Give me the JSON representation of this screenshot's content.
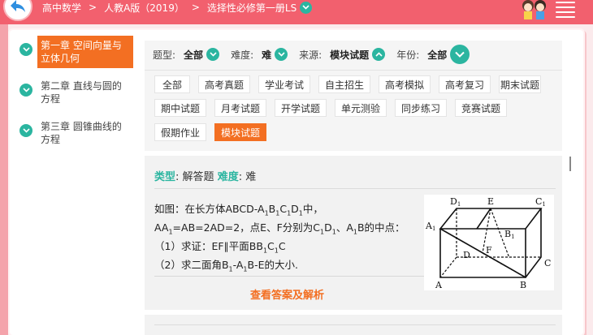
{
  "breadcrumb": {
    "subject": "高中数学",
    "sep1": ">",
    "edition": "人教A版（2019）",
    "sep2": ">",
    "book": "选择性必修第一册LS"
  },
  "chapters": [
    {
      "label": "第一章 空间向量与立体几何",
      "active": true
    },
    {
      "label": "第二章 直线与圆的方程",
      "active": false
    },
    {
      "label": "第三章 圆锥曲线的方程",
      "active": false
    }
  ],
  "filters": {
    "type_label": "题型:",
    "type_value": "全部",
    "difficulty_label": "难度:",
    "difficulty_value": "难",
    "source_label": "来源:",
    "source_value": "模块试题",
    "year_label": "年份:",
    "year_value": "全部"
  },
  "tags": [
    "全部",
    "高考真题",
    "学业考试",
    "自主招生",
    "高考模拟",
    "高考复习",
    "期末试题",
    "期中试题",
    "月考试题",
    "开学试题",
    "单元测验",
    "同步练习",
    "竞赛试题",
    "假期作业",
    "模块试题"
  ],
  "active_tag": "模块试题",
  "question": {
    "type_key": "类型",
    "type_value": "解答题",
    "difficulty_key": "难度",
    "difficulty_value": "难",
    "colon": ":",
    "answer_link": "查看答案及解析"
  },
  "figure_labels": [
    "D1",
    "E",
    "C1",
    "A1",
    "B1",
    "F",
    "D",
    "C",
    "A",
    "B"
  ],
  "colors": {
    "topbar": "#f2606e",
    "accent": "#f36f22",
    "teal": "#2bb5a0"
  }
}
